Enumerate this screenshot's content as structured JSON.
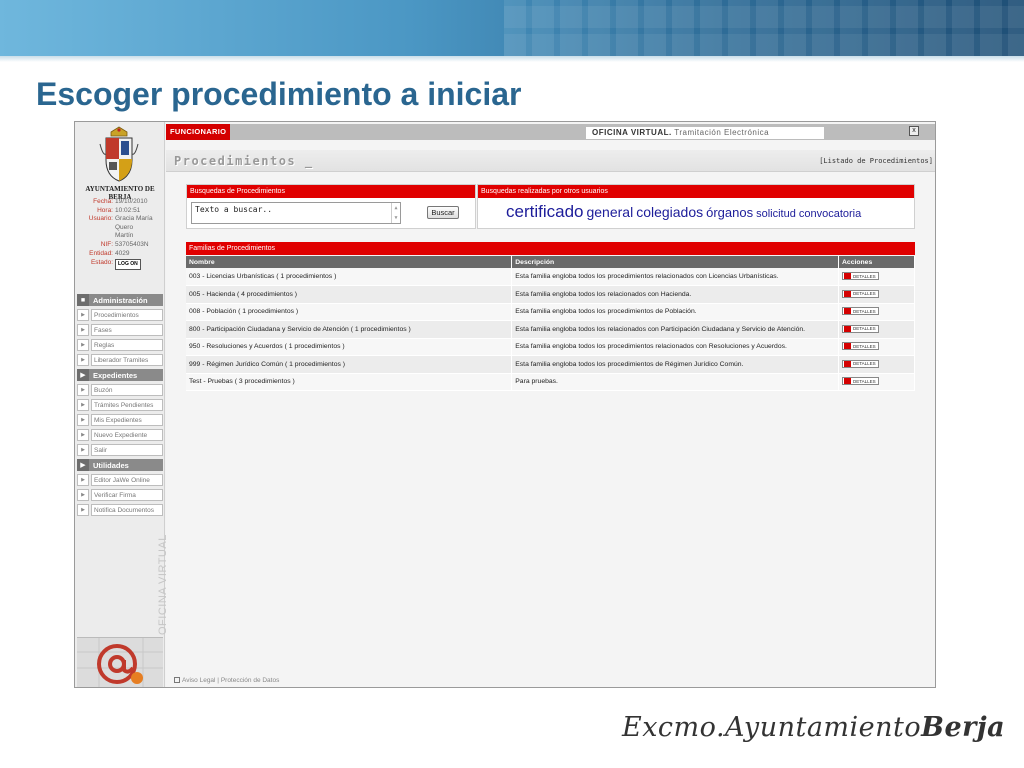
{
  "slide": {
    "title": "Escoger procedimiento a iniciar",
    "brand": [
      "Excmo.",
      "Ayuntamiento",
      "Berja"
    ]
  },
  "sidebar": {
    "org_name": "AYUNTAMIENTO DE BERJA",
    "info": [
      {
        "label": "Fecha:",
        "value": "19/10/2010"
      },
      {
        "label": "Hora:",
        "value": "10:02:51"
      },
      {
        "label": "Usuario:",
        "value": "Gracia María"
      },
      {
        "label": "",
        "value": "Quero"
      },
      {
        "label": "",
        "value": "Martín"
      },
      {
        "label": "NIF:",
        "value": "53705403N"
      },
      {
        "label": "Entidad:",
        "value": "4029"
      }
    ],
    "estado_label": "Estado:",
    "estado_button": "LOG ON",
    "sections": [
      {
        "title": "Administración",
        "items": [
          "Procedimientos",
          "Fases",
          "Reglas",
          "Liberador Tramites"
        ]
      },
      {
        "title": "Expedientes",
        "items": [
          "Buzón",
          "Trámites Pendientes",
          "Mis Expedientes",
          "Nuevo Expediente",
          "Salir"
        ]
      },
      {
        "title": "Utilidades",
        "items": [
          "Editor JaWe Online",
          "Verificar Firma",
          "Notifica Documentos"
        ]
      }
    ],
    "vertical_text": "OFICINA VIRTUAL"
  },
  "topbar": {
    "role": "FUNCIONARIO",
    "app_bold": "OFICINA VIRTUAL.",
    "app_sub": "Tramitación Electrónica",
    "close": "x"
  },
  "procedures": {
    "title": "Procedimientos _",
    "listing": "[Listado de Procedimientos]"
  },
  "search": {
    "head": "Busquedas de Procedimientos",
    "value": "Texto a buscar..",
    "button": "Buscar"
  },
  "popular": {
    "head": "Busquedas realizadas por otros usuarios",
    "tags": [
      {
        "text": "certificado",
        "size": 17
      },
      {
        "text": "general",
        "size": 14
      },
      {
        "text": "colegiados",
        "size": 14
      },
      {
        "text": "órganos",
        "size": 13
      },
      {
        "text": "solicitud",
        "size": 11
      },
      {
        "text": "convocatoria",
        "size": 11
      }
    ]
  },
  "families": {
    "head": "Familias de Procedimientos",
    "columns": [
      "Nombre",
      "Descripción",
      "Acciones"
    ],
    "rows": [
      {
        "name": "003 - Licencias Urbanísticas ( 1 procedimientos )",
        "desc": "Esta familia engloba todos los procedimientos relacionados con Licencias Urbanísticas.",
        "action": "DETALLES"
      },
      {
        "name": "005 - Hacienda ( 4 procedimientos )",
        "desc": "Esta familia engloba todos los relacionados con Hacienda.",
        "action": "DETALLES"
      },
      {
        "name": "008 - Población ( 1 procedimientos )",
        "desc": "Esta familia engloba todos los procedimientos de Población.",
        "action": "DETALLES"
      },
      {
        "name": "800 - Participación Ciudadana y Servicio de Atención ( 1 procedimientos )",
        "desc": "Esta familia engloba todos los relacionados con Participación Ciudadana y Servicio de Atención.",
        "action": "DETALLES"
      },
      {
        "name": "950 - Resoluciones y Acuerdos ( 1 procedimientos )",
        "desc": "Esta familia engloba todos los procedimientos relacionados con Resoluciones y Acuerdos.",
        "action": "DETALLES"
      },
      {
        "name": "999 - Régimen Jurídico Común ( 1 procedimientos )",
        "desc": "Esta familia engloba todos los procedimientos de Régimen Jurídico Común.",
        "action": "DETALLES"
      },
      {
        "name": "Test - Pruebas ( 3 procedimientos )",
        "desc": " Para pruebas.",
        "action": "DETALLES"
      }
    ]
  },
  "footer": {
    "legal": "Aviso Legal",
    "privacy": "Protección de Datos"
  },
  "colors": {
    "accent_red": "#e00000",
    "title_blue": "#2a6690",
    "tag_blue": "#1d1d9a"
  }
}
